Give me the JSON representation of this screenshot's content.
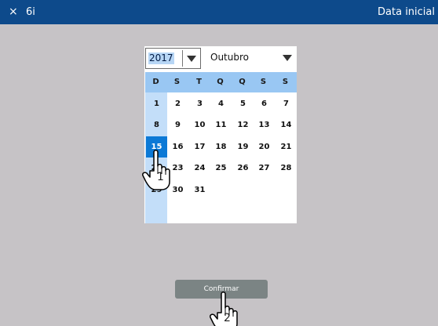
{
  "titlebar": {
    "close_icon": "×",
    "app_id": "6i",
    "title": "Data inicial"
  },
  "date_picker": {
    "year": "2017",
    "month": "Outubro",
    "weekdays": [
      "D",
      "S",
      "T",
      "Q",
      "Q",
      "S",
      "S"
    ],
    "weeks": [
      [
        "1",
        "2",
        "3",
        "4",
        "5",
        "6",
        "7"
      ],
      [
        "8",
        "9",
        "10",
        "11",
        "12",
        "13",
        "14"
      ],
      [
        "15",
        "16",
        "17",
        "18",
        "19",
        "20",
        "21"
      ],
      [
        "22",
        "23",
        "24",
        "25",
        "26",
        "27",
        "28"
      ],
      [
        "29",
        "30",
        "31"
      ]
    ],
    "selected_day": "15"
  },
  "confirm_button": {
    "label": "Confirmar"
  },
  "annotations": {
    "step1": "1",
    "step2": "2"
  },
  "colors": {
    "titlebar": "#0d4a8b",
    "background": "#c6c3c6",
    "weekday_header": "#99c7f3",
    "selected_day": "#0b79d6",
    "confirm_button": "#7b8484"
  }
}
